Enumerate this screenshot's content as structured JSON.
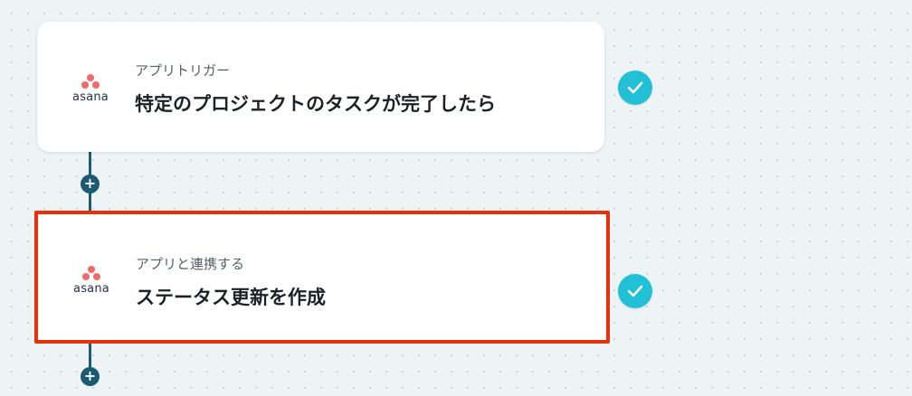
{
  "flow": {
    "steps": [
      {
        "app_logo": "asana-logo",
        "app_name": "asana",
        "step_type": "アプリトリガー",
        "title": "特定のプロジェクトのタスクが完了したら",
        "status_icon": "check-icon",
        "selected": false
      },
      {
        "app_logo": "asana-logo",
        "app_name": "asana",
        "step_type": "アプリと連携する",
        "title": "ステータス更新を作成",
        "status_icon": "check-icon",
        "selected": true
      }
    ],
    "add_step_icon": "+"
  },
  "colors": {
    "background": "#eef3f5",
    "connector": "#1f5b73",
    "check_badge": "#21c0d6",
    "selection_border": "#e8300c",
    "asana_brand": "#f06a6a"
  }
}
